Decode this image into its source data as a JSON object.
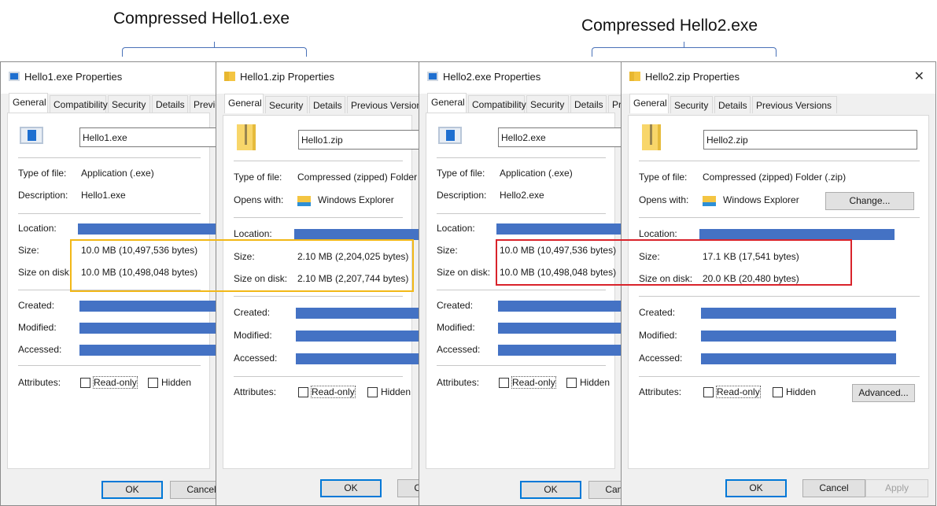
{
  "captions": [
    {
      "text": "Compressed  Hello1.exe"
    },
    {
      "text": "Compressed  Hello2.exe"
    }
  ],
  "highlight_colors": {
    "hello1": "#f2b817",
    "hello2": "#d9232b"
  },
  "dialogs": [
    {
      "variant": "exe",
      "title": "Hello1.exe Properties",
      "icon": "application-icon",
      "tabs": [
        "General",
        "Compatibility",
        "Security",
        "Details",
        "Previous Versions"
      ],
      "name": "Hello1.exe",
      "rows1": [
        {
          "label": "Type of file:",
          "value": "Application (.exe)"
        },
        {
          "label": "Description:",
          "value": "Hello1.exe"
        }
      ],
      "location_label": "Location:",
      "size_label": "Size:",
      "size": "10.0 MB (10,497,536 bytes)",
      "disk_label": "Size on disk:",
      "disk": "10.0 MB (10,498,048 bytes)",
      "dates": [
        "Created:",
        "Modified:",
        "Accessed:"
      ],
      "attributes_label": "Attributes:",
      "readonly": "Read-only",
      "hidden": "Hidden",
      "buttons": [
        "OK",
        "Cancel"
      ]
    },
    {
      "variant": "zip",
      "title": "Hello1.zip Properties",
      "icon": "zip-folder-icon",
      "tabs": [
        "General",
        "Security",
        "Details",
        "Previous Versions"
      ],
      "name": "Hello1.zip",
      "rows1": [
        {
          "label": "Type of file:",
          "value": "Compressed (zipped) Folder (.zip)"
        },
        {
          "label": "Opens with:",
          "value": "Windows Explorer"
        }
      ],
      "location_label": "Location:",
      "size_label": "Size:",
      "size": "2.10 MB (2,204,025 bytes)",
      "disk_label": "Size on disk:",
      "disk": "2.10 MB (2,207,744 bytes)",
      "dates": [
        "Created:",
        "Modified:",
        "Accessed:"
      ],
      "attributes_label": "Attributes:",
      "readonly": "Read-only",
      "hidden": "Hidden",
      "buttons": [
        "OK",
        "Cancel"
      ]
    },
    {
      "variant": "exe",
      "title": "Hello2.exe Properties",
      "icon": "application-icon",
      "tabs": [
        "General",
        "Compatibility",
        "Security",
        "Details",
        "Previous Versions"
      ],
      "name": "Hello2.exe",
      "rows1": [
        {
          "label": "Type of file:",
          "value": "Application (.exe)"
        },
        {
          "label": "Description:",
          "value": "Hello2.exe"
        }
      ],
      "location_label": "Location:",
      "size_label": "Size:",
      "size": "10.0 MB (10,497,536 bytes)",
      "disk_label": "Size on disk:",
      "disk": "10.0 MB (10,498,048 bytes)",
      "dates": [
        "Created:",
        "Modified:",
        "Accessed:"
      ],
      "attributes_label": "Attributes:",
      "readonly": "Read-only",
      "hidden": "Hidden",
      "buttons": [
        "OK",
        "Cancel"
      ]
    },
    {
      "variant": "zip",
      "title": "Hello2.zip Properties",
      "icon": "zip-folder-icon",
      "close": "✕",
      "tabs": [
        "General",
        "Security",
        "Details",
        "Previous Versions"
      ],
      "name": "Hello2.zip",
      "rows1": [
        {
          "label": "Type of file:",
          "value": "Compressed (zipped) Folder (.zip)"
        },
        {
          "label": "Opens with:",
          "value": "Windows Explorer"
        }
      ],
      "change": "Change...",
      "location_label": "Location:",
      "size_label": "Size:",
      "size": "17.1 KB (17,541 bytes)",
      "disk_label": "Size on disk:",
      "disk": "20.0 KB (20,480 bytes)",
      "dates": [
        "Created:",
        "Modified:",
        "Accessed:"
      ],
      "attributes_label": "Attributes:",
      "readonly": "Read-only",
      "hidden": "Hidden",
      "advanced": "Advanced...",
      "buttons": [
        "OK",
        "Cancel",
        "Apply"
      ]
    }
  ]
}
